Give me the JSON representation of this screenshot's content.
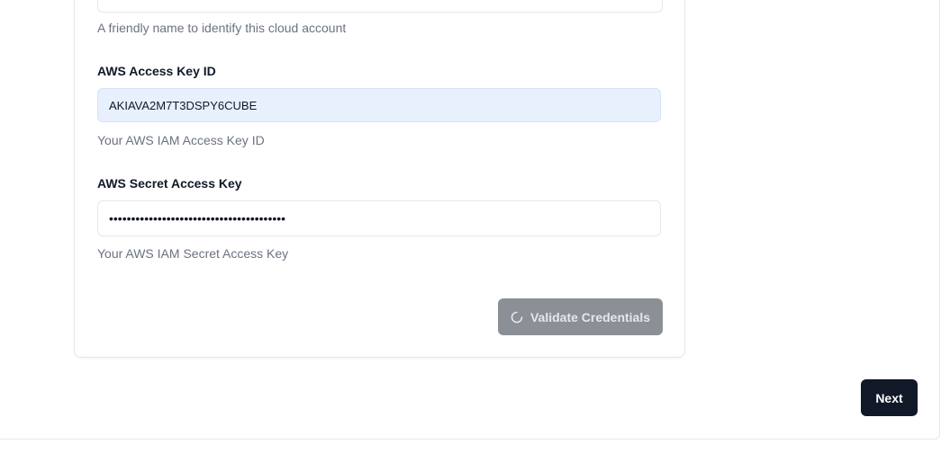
{
  "account_name": {
    "help": "A friendly name to identify this cloud account"
  },
  "access_key": {
    "label": "AWS Access Key ID",
    "value": "AKIAVA2M7T3DSPY6CUBE",
    "help": "Your AWS IAM Access Key ID"
  },
  "secret_key": {
    "label": "AWS Secret Access Key",
    "value": "••••••••••••••••••••••••••••••••••••••••",
    "help": "Your AWS IAM Secret Access Key"
  },
  "actions": {
    "validate_label": "Validate Credentials",
    "validate_icon": "loader-icon",
    "next_label": "Next"
  },
  "colors": {
    "validate_bg": "#8b8f96",
    "next_bg": "#111827",
    "autofill_bg": "#e8f0fe"
  }
}
